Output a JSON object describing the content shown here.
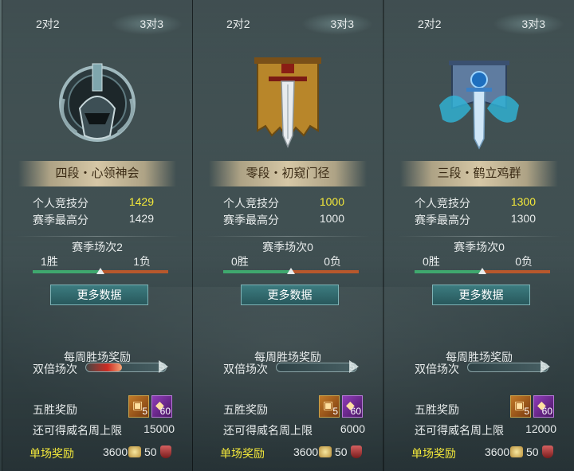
{
  "panels": [
    {
      "tabs": [
        "2对2",
        "3对3"
      ],
      "active_tab": 1,
      "emblem_icon": "dark-helm-emblem-icon",
      "rank": "四段・心领神会",
      "personal_label": "个人竞技分",
      "personal_value": "1429",
      "season_high_label": "赛季最高分",
      "season_high_value": "1429",
      "season_matches": "赛季场次2",
      "wins": "1胜",
      "losses": "1负",
      "win_fraction": 0.5,
      "more_data": "更多数据",
      "weekly_reward": "每周胜场奖励",
      "double_matches": "双倍场次",
      "double_progress": "5",
      "double_fill": 0.45,
      "five_win_reward": "五胜奖励",
      "item1_count": "5",
      "item2_count": "60",
      "weekly_cap_label": "还可得威名周上限",
      "weekly_cap_value": "15000",
      "single_reward": "单场奖励",
      "single_coin": "3600",
      "single_rep": "50"
    },
    {
      "tabs": [
        "2对2",
        "3对3"
      ],
      "active_tab": 1,
      "emblem_icon": "banner-sword-emblem-icon",
      "rank": "零段・初窥门径",
      "personal_label": "个人竞技分",
      "personal_value": "1000",
      "season_high_label": "赛季最高分",
      "season_high_value": "1000",
      "season_matches": "赛季场次0",
      "wins": "0胜",
      "losses": "0负",
      "win_fraction": 0.5,
      "more_data": "更多数据",
      "weekly_reward": "每周胜场奖励",
      "double_matches": "双倍场次",
      "double_progress": "5",
      "double_fill": 0,
      "five_win_reward": "五胜奖励",
      "item1_count": "5",
      "item2_count": "60",
      "weekly_cap_label": "还可得威名周上限",
      "weekly_cap_value": "6000",
      "single_reward": "单场奖励",
      "single_coin": "3600",
      "single_rep": "50"
    },
    {
      "tabs": [
        "2对2",
        "3对3"
      ],
      "active_tab": 1,
      "emblem_icon": "blue-crane-sword-emblem-icon",
      "rank": "三段・鹤立鸡群",
      "personal_label": "个人竞技分",
      "personal_value": "1300",
      "season_high_label": "赛季最高分",
      "season_high_value": "1300",
      "season_matches": "赛季场次0",
      "wins": "0胜",
      "losses": "0负",
      "win_fraction": 0.5,
      "more_data": "更多数据",
      "weekly_reward": "每周胜场奖励",
      "double_matches": "双倍场次",
      "double_progress": "5",
      "double_fill": 0,
      "five_win_reward": "五胜奖励",
      "item1_count": "5",
      "item2_count": "60",
      "weekly_cap_label": "还可得威名周上限",
      "weekly_cap_value": "12000",
      "single_reward": "单场奖励",
      "single_coin": "3600",
      "single_rep": "50"
    }
  ],
  "colors": {
    "highlight_score": "#f4e93a",
    "win_bar": "#3fa86e",
    "loss_bar": "#b8582c"
  }
}
